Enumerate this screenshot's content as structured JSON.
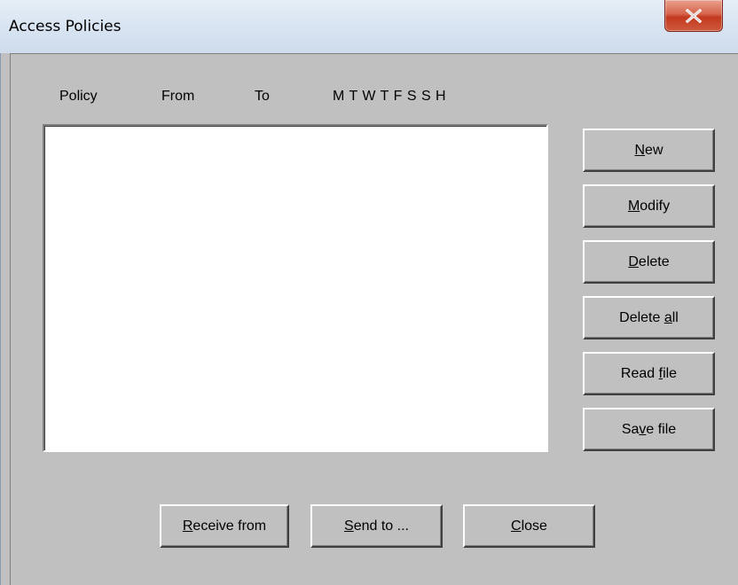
{
  "window": {
    "title": "Access Policies"
  },
  "columns": {
    "policy": "Policy",
    "from": "From",
    "to": "To",
    "days": "M T W T F S S H"
  },
  "policy_list": {
    "items": []
  },
  "buttons": {
    "new": {
      "pre": "",
      "key": "N",
      "post": "ew"
    },
    "modify": {
      "pre": "",
      "key": "M",
      "post": "odify"
    },
    "delete": {
      "pre": "",
      "key": "D",
      "post": "elete"
    },
    "delete_all": {
      "pre": "Delete ",
      "key": "a",
      "post": "ll"
    },
    "read_file": {
      "pre": "Read ",
      "key": "f",
      "post": "ile"
    },
    "save_file": {
      "pre": "Sa",
      "key": "v",
      "post": "e file"
    },
    "receive_from": {
      "pre": "",
      "key": "R",
      "post": "eceive from"
    },
    "send_to": {
      "pre": "",
      "key": "S",
      "post": "end to ..."
    },
    "close": {
      "pre": "",
      "key": "C",
      "post": "lose"
    }
  },
  "colors": {
    "dialog_face": "#c0c0c0",
    "titlebar": "#dbe6f3",
    "close_button": "#c7432a"
  },
  "icons": {
    "close": "close-x-icon"
  }
}
